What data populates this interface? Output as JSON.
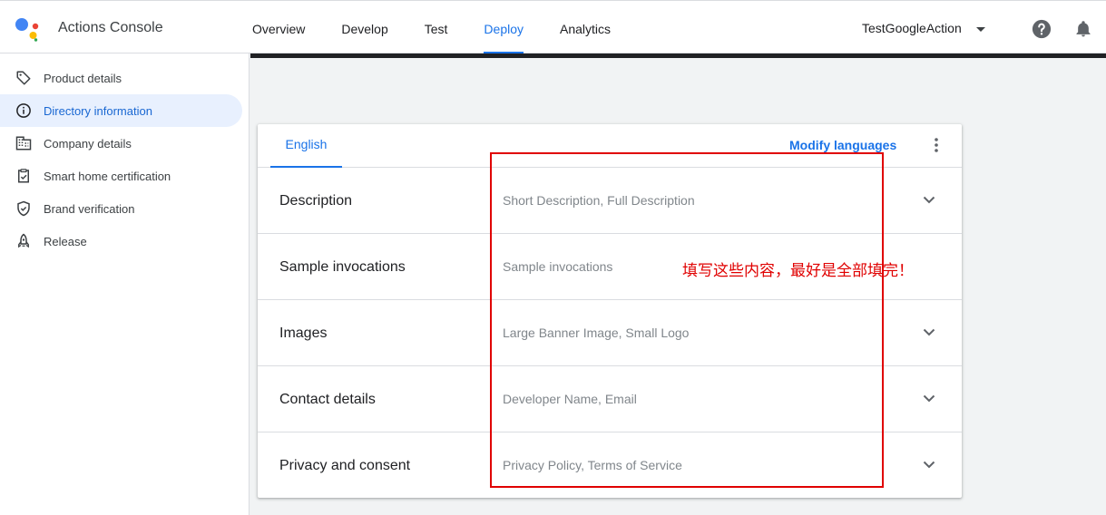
{
  "app": {
    "title": "Actions Console"
  },
  "nav": {
    "tabs": [
      {
        "label": "Overview"
      },
      {
        "label": "Develop"
      },
      {
        "label": "Test"
      },
      {
        "label": "Deploy"
      },
      {
        "label": "Analytics"
      }
    ],
    "active": "Deploy"
  },
  "project": {
    "name": "TestGoogleAction"
  },
  "icons": {
    "help": "help-circle-icon",
    "notifications": "bell-icon",
    "more": "more-vert-icon"
  },
  "sidebar": {
    "items": [
      {
        "label": "Product details",
        "icon": "tag-icon"
      },
      {
        "label": "Directory information",
        "icon": "info-icon"
      },
      {
        "label": "Company details",
        "icon": "building-icon"
      },
      {
        "label": "Smart home certification",
        "icon": "clipboard-check-icon"
      },
      {
        "label": "Brand verification",
        "icon": "shield-check-icon"
      },
      {
        "label": "Release",
        "icon": "rocket-icon"
      }
    ],
    "active": "Directory information"
  },
  "card": {
    "language_tab": "English",
    "modify_languages": "Modify languages",
    "sections": [
      {
        "title": "Description",
        "summary": "Short Description, Full Description",
        "expandable": true
      },
      {
        "title": "Sample invocations",
        "summary": "Sample invocations",
        "expandable": false
      },
      {
        "title": "Images",
        "summary": "Large Banner Image, Small Logo",
        "expandable": true
      },
      {
        "title": "Contact details",
        "summary": "Developer Name, Email",
        "expandable": true
      },
      {
        "title": "Privacy and consent",
        "summary": "Privacy Policy, Terms of Service",
        "expandable": true
      }
    ]
  },
  "annotation": {
    "text": "填写这些内容，最好是全部填完！",
    "color": "#e00000"
  },
  "colors": {
    "accent": "#1a73e8",
    "active_bg": "#e8f0fe",
    "content_bg": "#f1f3f4"
  }
}
